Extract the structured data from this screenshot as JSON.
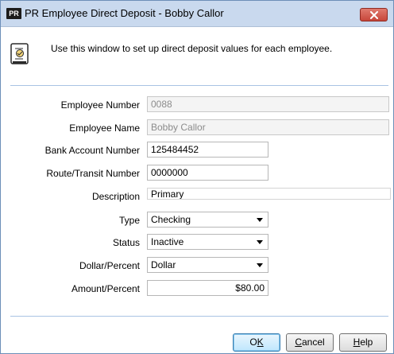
{
  "window": {
    "app_badge": "PR",
    "title": "PR Employee Direct Deposit - Bobby Callor"
  },
  "header": {
    "instruction": "Use this window to set up direct deposit values for each employee."
  },
  "form": {
    "employee_number": {
      "label": "Employee Number",
      "value": "0088"
    },
    "employee_name": {
      "label": "Employee Name",
      "value": "Bobby Callor"
    },
    "bank_account_number": {
      "label": "Bank Account Number",
      "value": "125484452"
    },
    "route_transit_number": {
      "label": "Route/Transit Number",
      "value": "0000000"
    },
    "description": {
      "label": "Description",
      "value": "Primary"
    },
    "type": {
      "label": "Type",
      "value": "Checking"
    },
    "status": {
      "label": "Status",
      "value": "Inactive"
    },
    "dollar_percent": {
      "label": "Dollar/Percent",
      "value": "Dollar"
    },
    "amount_percent": {
      "label": "Amount/Percent",
      "value": "$80.00"
    }
  },
  "buttons": {
    "ok": {
      "mnemonic": "K",
      "prefix": "O",
      "suffix": ""
    },
    "cancel": {
      "mnemonic": "C",
      "prefix": "",
      "suffix": "ancel"
    },
    "help": {
      "mnemonic": "H",
      "prefix": "",
      "suffix": "elp"
    }
  },
  "icons": {
    "app": "pr-app-icon",
    "close": "close-icon",
    "document": "document-icon",
    "dropdown": "chevron-down-icon"
  },
  "colors": {
    "titlebar": "#c9d9ee",
    "close_button": "#c7463a",
    "separator": "#a9c3e3",
    "default_button_border": "#3c7fb1"
  }
}
